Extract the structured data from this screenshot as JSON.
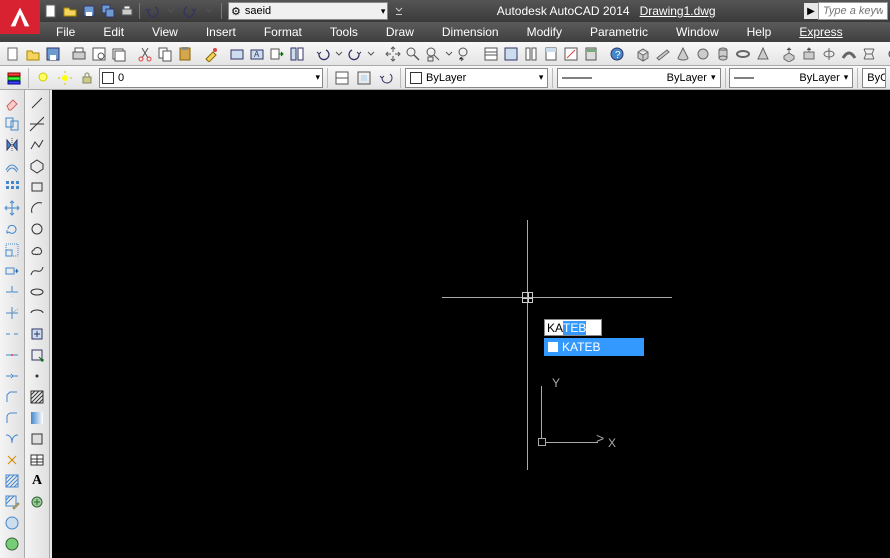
{
  "title": {
    "app": "Autodesk AutoCAD 2014",
    "doc": "Drawing1.dwg"
  },
  "workspace": {
    "label": "saeid"
  },
  "search": {
    "placeholder": "Type a keyword"
  },
  "menus": [
    "File",
    "Edit",
    "View",
    "Insert",
    "Format",
    "Tools",
    "Draw",
    "Dimension",
    "Modify",
    "Parametric",
    "Window",
    "Help",
    "Express"
  ],
  "layer": {
    "current": "0"
  },
  "props": {
    "color": "ByLayer",
    "linetype": "ByLayer",
    "lineweight": "ByLayer",
    "extra": "ByC"
  },
  "command": {
    "typed": "KA",
    "completion": "TEB",
    "suggestion": "KATEB"
  },
  "ucs": {
    "x": "X",
    "y": "Y"
  }
}
